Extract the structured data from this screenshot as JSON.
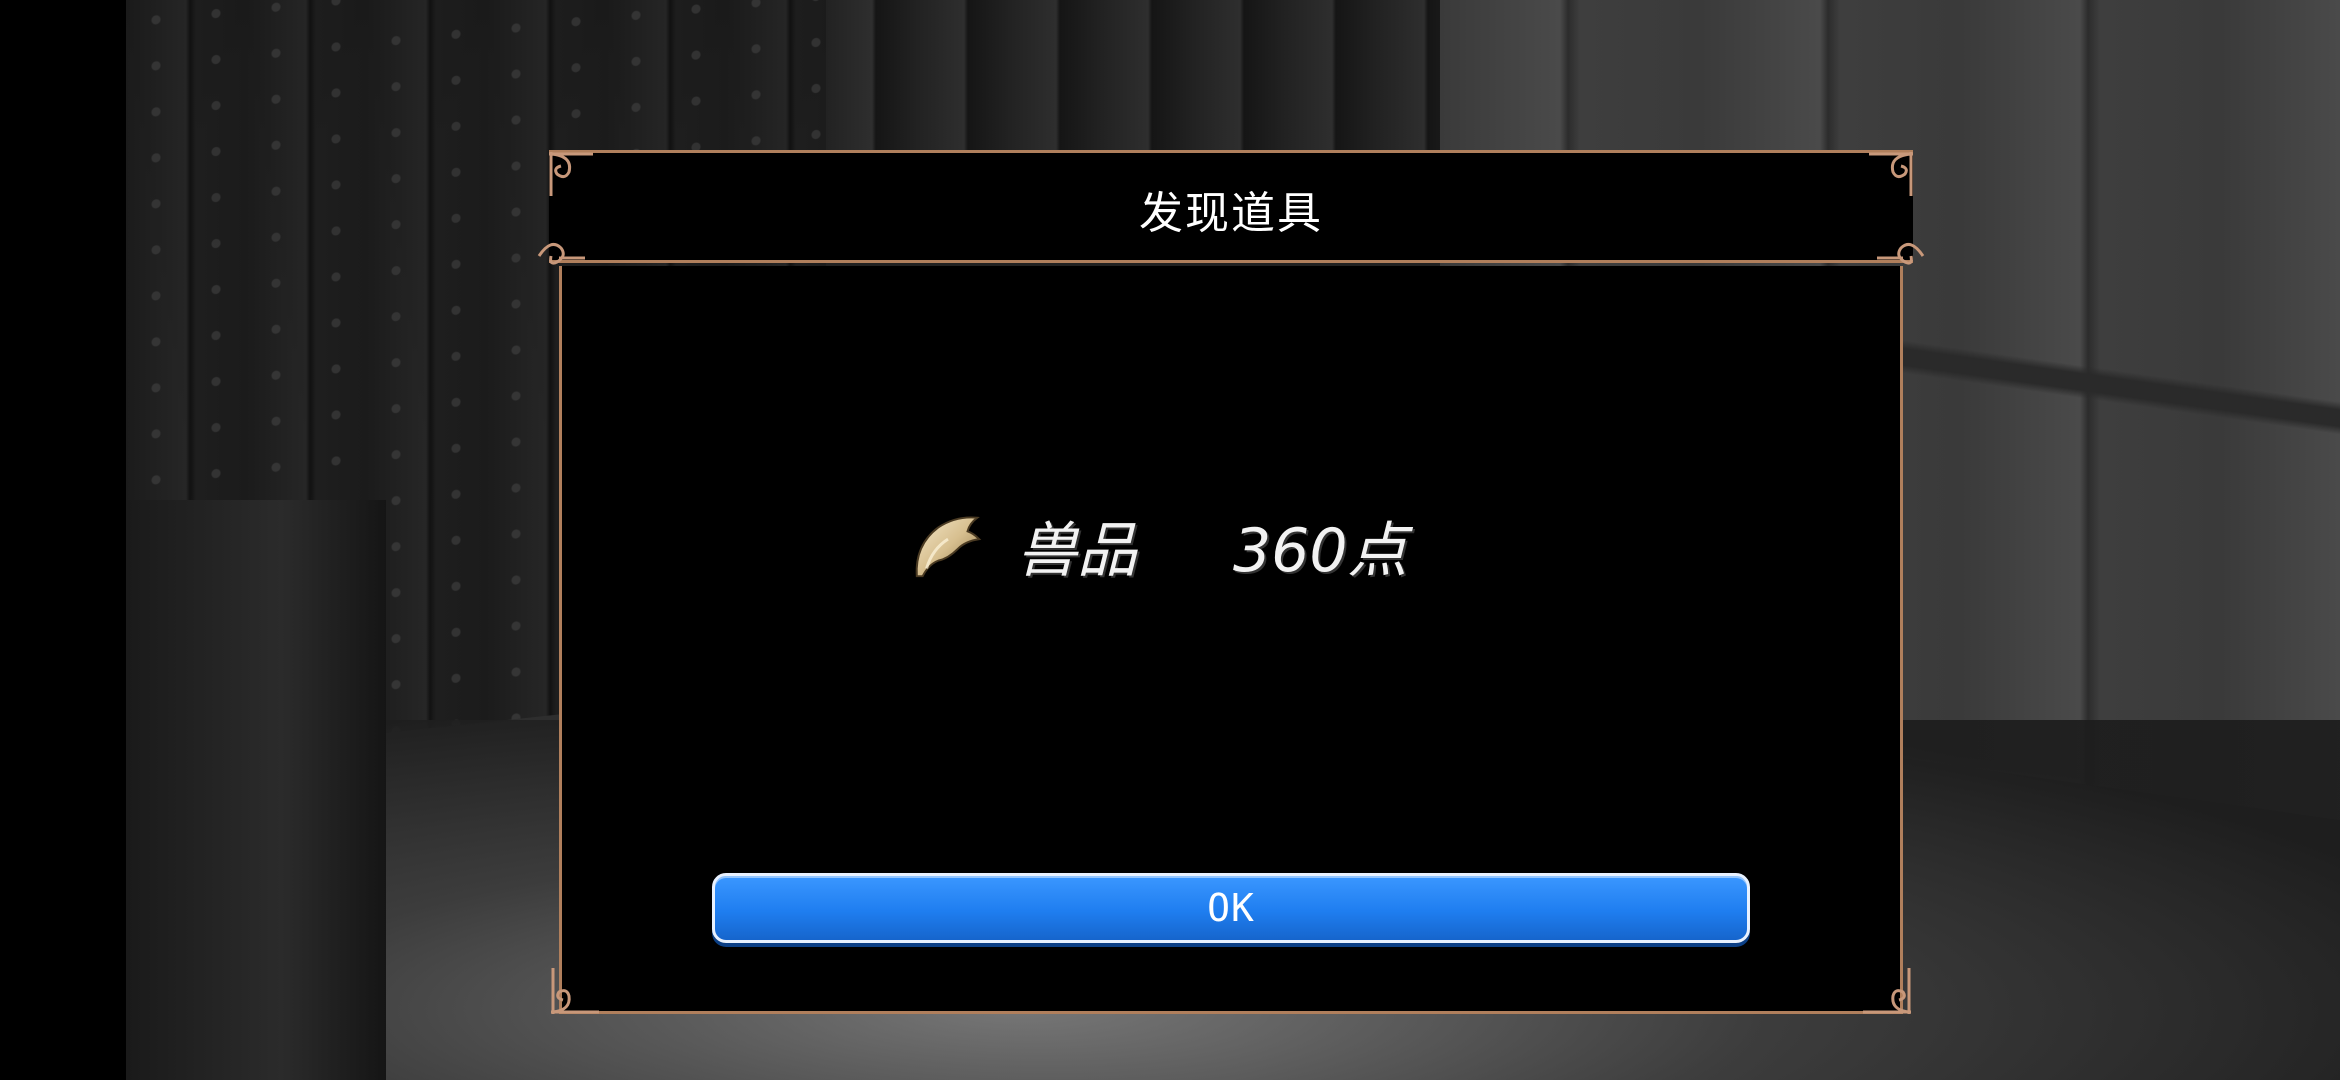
{
  "dialog": {
    "title": "发现道具",
    "item": {
      "name": "兽品",
      "amount": "360点",
      "icon": "claw-icon"
    },
    "ok_label": "OK"
  },
  "colors": {
    "frame": "#b07f5c",
    "ornament": "#c8987a",
    "button": "#1f7ef0",
    "text": "#ffffff"
  }
}
